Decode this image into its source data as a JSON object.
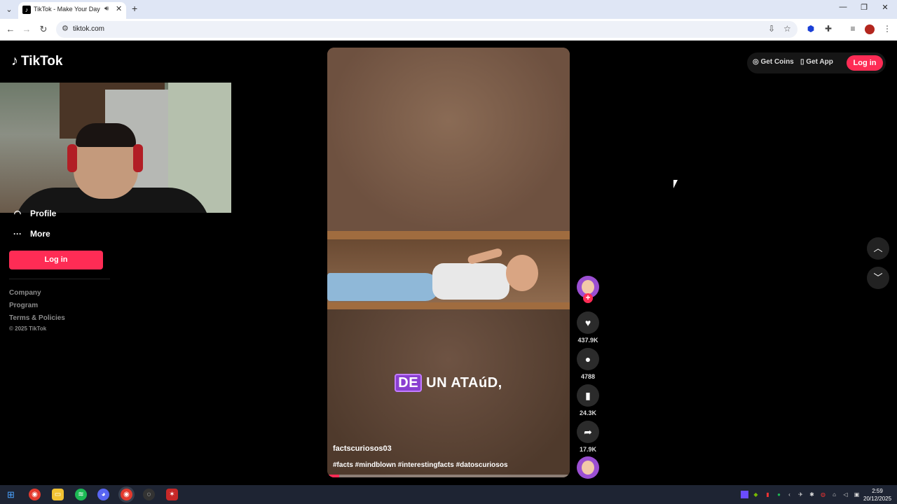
{
  "browser": {
    "tab_title": "TikTok - Make Your Day",
    "url": "tiktok.com"
  },
  "tiktok": {
    "logo_text": "TikTok",
    "sidebar": [
      {
        "label": "Profile",
        "icon": "person-icon"
      },
      {
        "label": "More",
        "icon": "more-icon"
      }
    ],
    "sidebar_login": "Log in",
    "footer_links": [
      "Company",
      "Program",
      "Terms & Policies"
    ],
    "copyright": "© 2025 TikTok",
    "top_actions": {
      "get_coins": "Get Coins",
      "get_app": "Get App",
      "login": "Log in"
    },
    "video": {
      "caption_highlight": "DE",
      "caption_rest": " UN ATAúD,",
      "author": "factscuriosos03",
      "hashtags": "#facts #mindblown #interestingfacts #datoscuriosos",
      "progress": 0.05
    },
    "actions": {
      "likes": "437.9K",
      "comments": "4788",
      "saves": "24.3K",
      "shares": "17.9K"
    }
  },
  "taskbar": {
    "time": "2:59",
    "date": "20/12/2025"
  },
  "colors": {
    "brand": "#fe2c55",
    "caption_highlight": "#8a3fd1"
  }
}
